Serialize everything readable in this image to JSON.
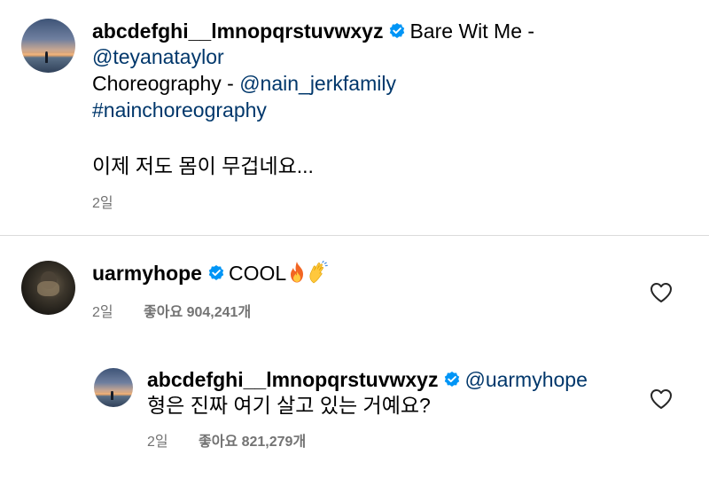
{
  "post": {
    "username": "abcdefghi__lmnopqrstuvwxyz",
    "caption_song": "Bare Wit Me -",
    "caption_artist_mention": "@teyanataylor",
    "caption_choreo_label": "Choreography -",
    "caption_choreo_mention": "@nain_jerkfamily",
    "caption_hashtag": "#nainchoreography",
    "caption_text": "이제 저도 몸이 무겁네요...",
    "time": "2일"
  },
  "comments": [
    {
      "username": "uarmyhope",
      "text": "COOL",
      "emojis": [
        "flame-emoji",
        "clapping-hands-emoji"
      ],
      "time": "2일",
      "likes_label": "좋아요 904,241개"
    },
    {
      "username": "abcdefghi__lmnopqrstuvwxyz",
      "mention": "@uarmyhope",
      "text": "형은 진짜 여기 살고 있는 거예요?",
      "time": "2일",
      "likes_label": "좋아요 821,279개"
    }
  ],
  "icons": {
    "verified": "verified-badge-icon",
    "like": "heart-icon"
  },
  "colors": {
    "link": "#00376b",
    "verified": "#0095f6",
    "meta": "#737373",
    "divider": "#dbdbdb"
  }
}
